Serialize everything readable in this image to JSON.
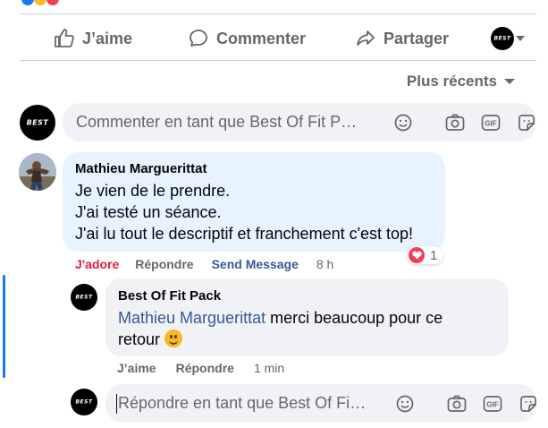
{
  "colors": {
    "accent": "#1877f2",
    "love": "#f33e58",
    "bubble": "#f0f2f5",
    "bubble_highlight": "#e7f3ff",
    "text_muted": "#65676b"
  },
  "actions": [
    {
      "label": "J’aime",
      "icon": "like-icon"
    },
    {
      "label": "Commenter",
      "icon": "comment-icon"
    },
    {
      "label": "Partager",
      "icon": "share-icon"
    }
  ],
  "sort": {
    "label": "Plus récents"
  },
  "page_avatar": {
    "logo_text": "BEST"
  },
  "comment_input": {
    "placeholder": "Commenter en tant que Best Of Fit P…"
  },
  "comment": {
    "author": "Mathieu Marguerittat",
    "lines": [
      "Je vien de le prendre.",
      "J'ai testé un séance.",
      "J'ai lu tout le descriptif et franchement c'est top!"
    ],
    "reaction_count": "1",
    "actions": {
      "react": "J'adore",
      "reply": "Répondre",
      "message": "Send Message",
      "time": "8 h"
    }
  },
  "reply": {
    "author": "Best Of Fit Pack",
    "mention": "Mathieu Marguerittat",
    "text": " merci beaucoup pour ce retour ",
    "actions": {
      "react": "J’aime",
      "reply": "Répondre",
      "time": "1 min"
    }
  },
  "reply_input": {
    "placeholder": "Répondre en tant que Best Of Fi…"
  }
}
